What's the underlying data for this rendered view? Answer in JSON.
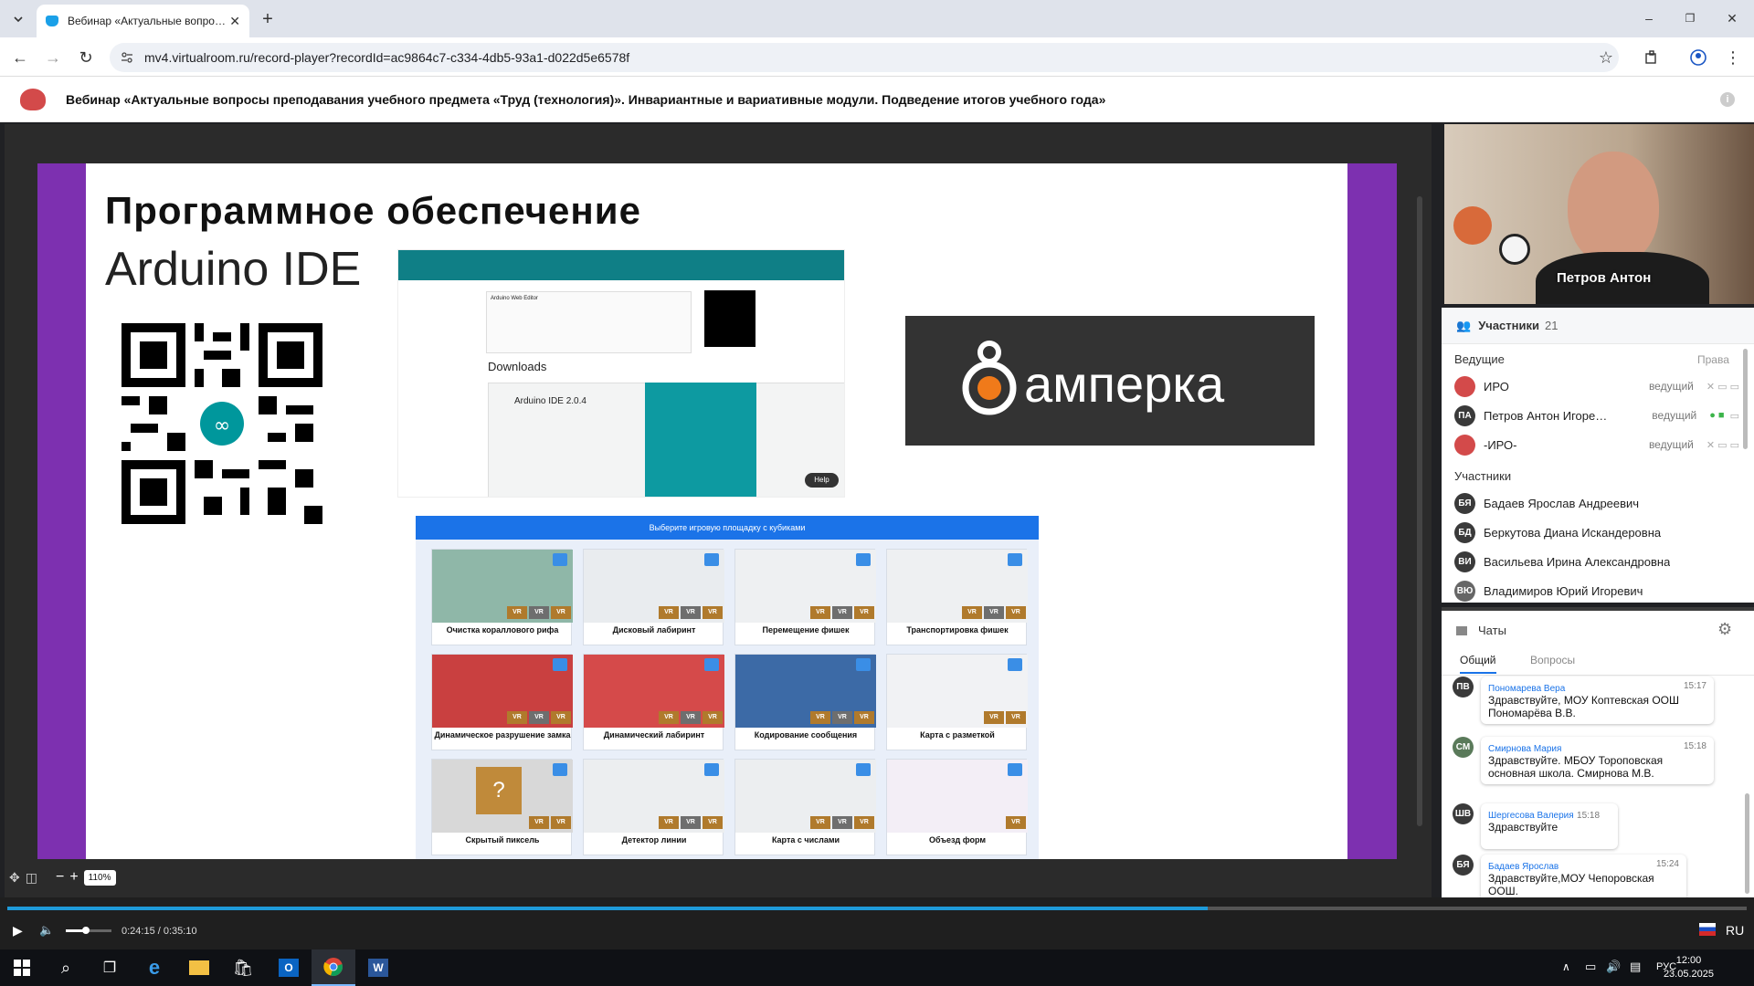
{
  "browser": {
    "tab_title": "Вебинар «Актуальные вопросы преподавания",
    "url": "mv4.virtualroom.ru/record-player?recordId=ac9864c7-c334-4db5-93a1-d022d5e6578f",
    "icons": [
      "tab-search-icon",
      "close-icon",
      "new-tab-icon",
      "back-icon",
      "forward-icon",
      "reload-icon",
      "site-info-icon",
      "bookmark-star-icon",
      "extensions-icon",
      "profile-icon",
      "menu-icon",
      "minimize-icon",
      "restore-icon"
    ]
  },
  "header": {
    "title": "Вебинар «Актуальные вопросы преподавания учебного предмета «Труд (технология)». Инвариантные и вариативные модули. Подведение итогов учебного года»"
  },
  "slide": {
    "title": "Программное обеспечение",
    "subtitle": "Arduino IDE",
    "arduino_editor": "Arduino Web Editor",
    "downloads": "Downloads",
    "ide_version": "Arduino IDE 2.0.4",
    "help": "Help",
    "amperka": "амперка",
    "games_header": "Выберите игровую площадку с кубиками",
    "games": [
      "Очистка кораллового рифа",
      "Дисковый лабиринт",
      "Перемещение фишек",
      "Транспортировка фишек",
      "Динамическое разрушение замка",
      "Динамический лабиринт",
      "Кодирование сообщения",
      "Карта с разметкой",
      "Скрытый пиксель",
      "Детектор линии",
      "Карта с числами",
      "Объезд форм"
    ],
    "vr": "VR"
  },
  "zoom": {
    "level": "110%"
  },
  "video": {
    "speaker": "Петров Антон"
  },
  "participants": {
    "title": "Участники",
    "count": "21",
    "hosts_label": "Ведущие",
    "rights_label": "Права",
    "role": "ведущий",
    "hosts": [
      {
        "initials": "",
        "name": "ИРО"
      },
      {
        "initials": "ПА",
        "name": "Петров Антон Игоревич"
      },
      {
        "initials": "",
        "name": "-ИРО-"
      }
    ],
    "members_label": "Участники",
    "members": [
      {
        "initials": "БЯ",
        "name": "Бадаев Ярослав Андреевич"
      },
      {
        "initials": "БД",
        "name": "Беркутова Диана Искандеровна"
      },
      {
        "initials": "ВИ",
        "name": "Васильева Ирина Александровна"
      },
      {
        "initials": "ВЮ",
        "name": "Владимиров Юрий Игоревич"
      }
    ]
  },
  "chat": {
    "title": "Чаты",
    "tabs": [
      "Общий",
      "Вопросы"
    ],
    "messages": [
      {
        "initials": "ПВ",
        "name": "Пономарева Вера",
        "time": "15:17",
        "text": "Здравствуйте, МОУ Коптевская ООШ Пономарёва В.В."
      },
      {
        "initials": "СМ",
        "name": "Смирнова Мария",
        "time": "15:18",
        "text": "Здравствуйте. МБОУ Тороповская основная школа. Смирнова М.В."
      },
      {
        "initials": "ШВ",
        "name": "Шергесова Валерия",
        "time": "15:18",
        "text": "Здравствуйте"
      },
      {
        "initials": "БЯ",
        "name": "Бадаев Ярослав",
        "time": "15:24",
        "text": "Здравствуйте,МОУ Чепоровская ООШ."
      }
    ]
  },
  "player": {
    "time": "0:24:15 / 0:35:10",
    "progress": 0.69,
    "language": "RU"
  },
  "taskbar": {
    "lang": "РУС",
    "time": "12:00",
    "date": "23.05.2025"
  }
}
